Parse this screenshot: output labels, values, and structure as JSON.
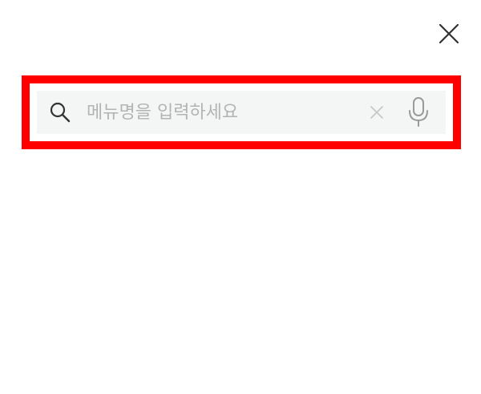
{
  "header": {
    "close_icon": "close-icon"
  },
  "search": {
    "placeholder": "메뉴명을 입력하세요",
    "value": "",
    "search_icon": "search-icon",
    "clear_icon": "clear-icon",
    "mic_icon": "microphone-icon"
  },
  "colors": {
    "highlight_border": "#ff0000",
    "search_background": "#f4f6f5",
    "icon_dark": "#333333",
    "icon_light": "#c8c8c8",
    "placeholder": "#b3b3b3"
  }
}
